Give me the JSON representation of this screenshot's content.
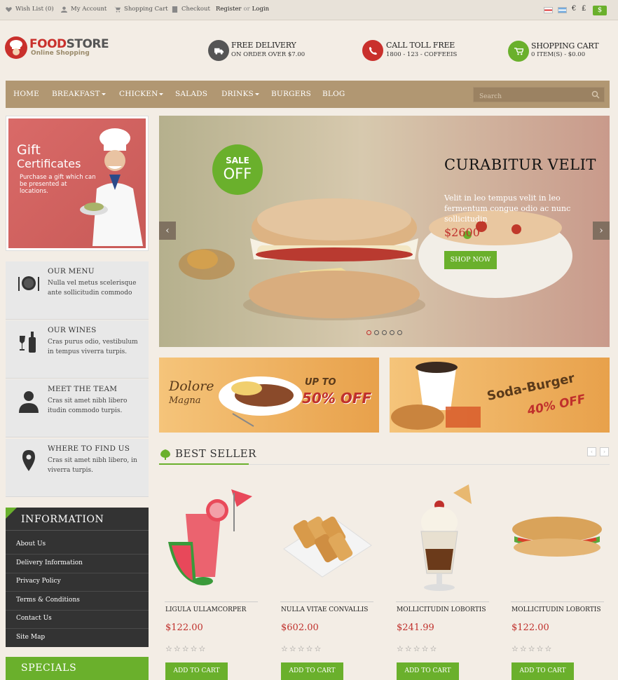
{
  "topbar": {
    "wishlist": "Wish List (0)",
    "account": "My Account",
    "cart": "Shopping Cart",
    "checkout": "Checkout",
    "register": "Register",
    "or": "or",
    "login": "Login",
    "currencies": [
      "€",
      "£",
      "$"
    ]
  },
  "header": {
    "logo_part1": "FOOD",
    "logo_part2": "STORE",
    "logo_sub": "Online Shopping",
    "delivery_title": "FREE DELIVERY",
    "delivery_sub": "ON ORDER OVER $7.00",
    "call_title": "CALL TOLL FREE",
    "call_sub": "1800 - 123 - COFFEEIS",
    "cart_title": "SHOPPING CART",
    "cart_sub": "0 ITEM(S) - $0.00"
  },
  "nav": {
    "items": [
      "HOME",
      "BREAKFAST",
      "CHICKEN",
      "SALADS",
      "DRINKS",
      "BURGERS",
      "BLOG"
    ],
    "search_placeholder": "Search"
  },
  "sidebar": {
    "gift_title1": "Gift",
    "gift_title2": "Certificates",
    "gift_sub": "Purchase a gift which can be presented at locations.",
    "features": [
      {
        "title": "OUR MENU",
        "desc": "Nulla vel metus scelerisque ante sollicitudin commodo"
      },
      {
        "title": "OUR WINES",
        "desc": "Cras purus odio, vestibulum in tempus viverra turpis."
      },
      {
        "title": "MEET THE TEAM",
        "desc": "Cras sit amet nibh libero itudin commodo turpis."
      },
      {
        "title": "WHERE TO FIND US",
        "desc": "Cras sit amet nibh libero, in viverra turpis."
      }
    ],
    "info_title": "INFORMATION",
    "info_links": [
      "About Us",
      "Delivery Information",
      "Privacy Policy",
      "Terms & Conditions",
      "Contact Us",
      "Site Map"
    ],
    "specials_title": "SPECIALS"
  },
  "slider": {
    "sale_line1": "SALE",
    "sale_line2": "OFF",
    "title": "CURABITUR VELIT",
    "desc": "Velit in leo tempus velit in leo fermentum congue odio ac nunc sollicitudin",
    "price": "$2600",
    "button": "SHOP NOW",
    "prev": "‹",
    "next": "›"
  },
  "banners": {
    "b1_word1": "Dolore",
    "b1_word2": "Magna",
    "b1_upto": "UP TO",
    "b1_off": "50% OFF",
    "b2_name": "Soda-Burger",
    "b2_off": "40% OFF"
  },
  "bestseller": {
    "title": "BEST SELLER",
    "products": [
      {
        "name": "LIGULA ULLAMCORPER",
        "price": "$122.00",
        "stars": "☆☆☆☆☆",
        "button": "ADD TO CART"
      },
      {
        "name": "NULLA VITAE CONVALLIS",
        "price": "$602.00",
        "stars": "☆☆☆☆☆",
        "button": "ADD TO CART"
      },
      {
        "name": "MOLLICITUDIN LOBORTIS",
        "price": "$241.99",
        "stars": "☆☆☆☆☆",
        "button": "ADD TO CART"
      },
      {
        "name": "MOLLICITUDIN LOBORTIS",
        "price": "$122.00",
        "stars": "☆☆☆☆☆",
        "button": "ADD TO CART"
      }
    ]
  }
}
